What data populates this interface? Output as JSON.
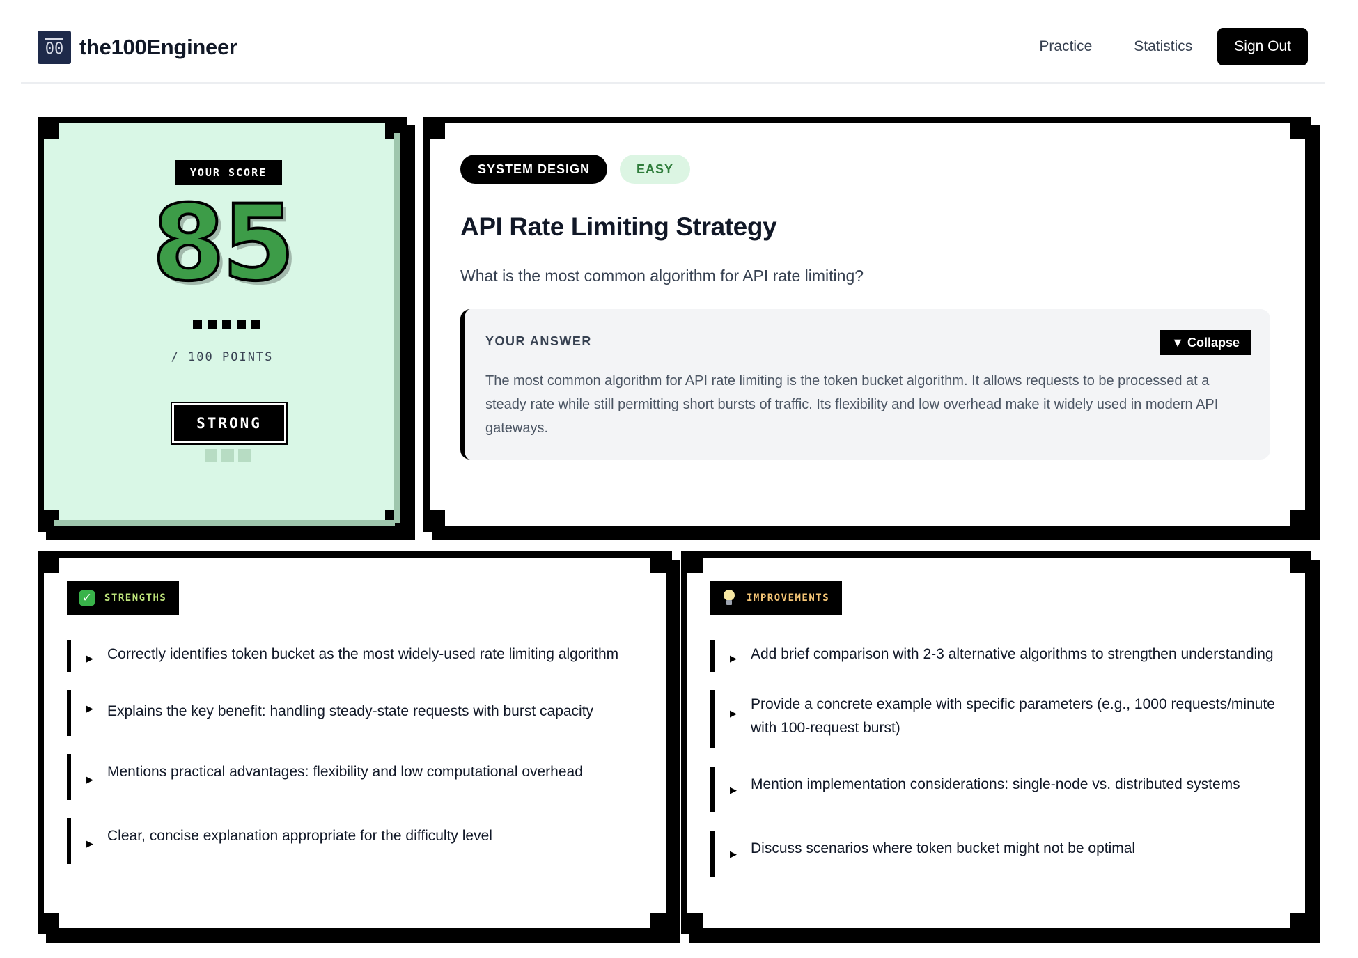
{
  "header": {
    "logo_mark": "00",
    "app_name": "the100Engineer",
    "nav": {
      "practice": "Practice",
      "statistics": "Statistics",
      "sign_out": "Sign Out"
    }
  },
  "score": {
    "label": "YOUR SCORE",
    "value": "85",
    "out_of": "/ 100 POINTS",
    "rating": "STRONG",
    "accent_color": "#3d9c48",
    "panel_color": "#d9f7e6"
  },
  "question": {
    "category": "SYSTEM DESIGN",
    "difficulty": "EASY",
    "title": "API Rate Limiting Strategy",
    "prompt": "What is the most common algorithm for API rate limiting?",
    "answer_label": "YOUR ANSWER",
    "collapse_label": "▼ Collapse",
    "answer_text": "The most common algorithm for API rate limiting is the token bucket algorithm. It allows requests to be processed at a steady rate while still permitting short bursts of traffic. Its flexibility and low overhead make it widely used in modern API gateways."
  },
  "strengths": {
    "title": "STRENGTHS",
    "icon": "check-icon",
    "items": [
      "Correctly identifies token bucket as the most widely-used rate limiting algorithm",
      "Explains the key benefit: handling steady-state requests with burst capacity",
      "Mentions practical advantages: flexibility and low computational overhead",
      "Clear, concise explanation appropriate for the difficulty level"
    ]
  },
  "improvements": {
    "title": "IMPROVEMENTS",
    "icon": "lightbulb-icon",
    "items": [
      "Add brief comparison with 2-3 alternative algorithms to strengthen understanding",
      "Provide a concrete example with specific parameters (e.g., 1000 requests/minute with 100-request burst)",
      "Mention implementation considerations: single-node vs. distributed systems",
      "Discuss scenarios where token bucket might not be optimal"
    ]
  }
}
